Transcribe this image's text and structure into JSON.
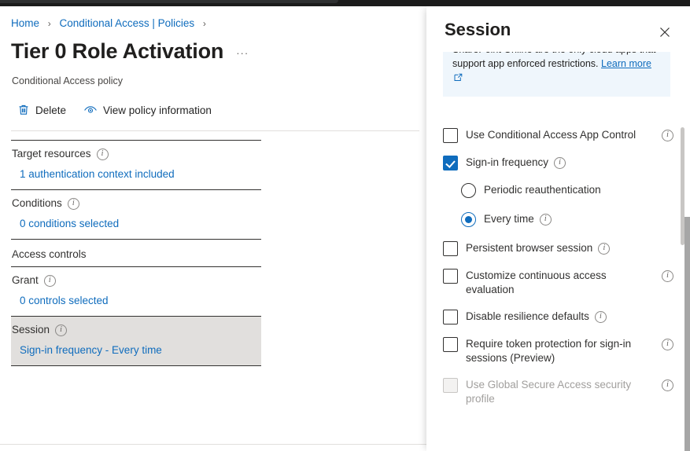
{
  "breadcrumb": {
    "items": [
      "Home",
      "Conditional Access | Policies"
    ],
    "separator": "›"
  },
  "header": {
    "title": "Tier 0 Role Activation",
    "ellipsis": "···",
    "subtitle": "Conditional Access policy"
  },
  "commandbar": {
    "delete_label": "Delete",
    "view_policy_label": "View policy information"
  },
  "sections": [
    {
      "name": "target-resources",
      "label": "Target resources",
      "has_info": true,
      "value": "1 authentication context included",
      "selected": false
    },
    {
      "name": "conditions",
      "label": "Conditions",
      "has_info": true,
      "value": "0 conditions selected",
      "selected": false
    },
    {
      "name": "access-controls",
      "label": "Access controls",
      "has_info": false,
      "value": null,
      "selected": false
    },
    {
      "name": "grant",
      "label": "Grant",
      "has_info": true,
      "value": "0 controls selected",
      "selected": false
    },
    {
      "name": "session",
      "label": "Session",
      "has_info": true,
      "value": "Sign-in frequency - Every time",
      "selected": true
    }
  ],
  "panel": {
    "title": "Session",
    "close_label": "✕",
    "info_banner": {
      "text_clipped": "SharePoint Online are the only cloud apps that support app enforced restrictions.",
      "link_label": "Learn more"
    },
    "options": [
      {
        "name": "use-conditional-access-app-control",
        "type": "checkbox",
        "label": "Use Conditional Access App Control",
        "checked": false,
        "disabled": false,
        "info": true,
        "info_position": "trailing",
        "indent": false
      },
      {
        "name": "sign-in-frequency",
        "type": "checkbox",
        "label": "Sign-in frequency",
        "checked": true,
        "disabled": false,
        "info": true,
        "info_position": "inline",
        "indent": false
      },
      {
        "name": "periodic-reauthentication",
        "type": "radio",
        "label": "Periodic reauthentication",
        "checked": false,
        "disabled": false,
        "info": false,
        "info_position": "none",
        "indent": true
      },
      {
        "name": "every-time",
        "type": "radio",
        "label": "Every time",
        "checked": true,
        "disabled": false,
        "info": true,
        "info_position": "inline",
        "indent": true
      },
      {
        "name": "persistent-browser-session",
        "type": "checkbox",
        "label": "Persistent browser session",
        "checked": false,
        "disabled": false,
        "info": true,
        "info_position": "inline",
        "indent": false
      },
      {
        "name": "customize-continuous-access-evaluation",
        "type": "checkbox",
        "label": "Customize continuous access evaluation",
        "checked": false,
        "disabled": false,
        "info": true,
        "info_position": "trailing",
        "indent": false
      },
      {
        "name": "disable-resilience-defaults",
        "type": "checkbox",
        "label": "Disable resilience defaults",
        "checked": false,
        "disabled": false,
        "info": true,
        "info_position": "inline",
        "indent": false
      },
      {
        "name": "require-token-protection",
        "type": "checkbox",
        "label": "Require token protection for sign-in sessions (Preview)",
        "checked": false,
        "disabled": false,
        "info": true,
        "info_position": "trailing",
        "indent": false
      },
      {
        "name": "use-global-secure-access-security-profile",
        "type": "checkbox",
        "label": "Use Global Secure Access security profile",
        "checked": false,
        "disabled": true,
        "info": true,
        "info_position": "trailing",
        "indent": false
      }
    ]
  },
  "colors": {
    "accent": "#0f6cbd",
    "link": "#0f6cbd",
    "selected_row_bg": "#e1dfdd",
    "info_banner_bg": "#eff6fc",
    "text": "#323130"
  }
}
